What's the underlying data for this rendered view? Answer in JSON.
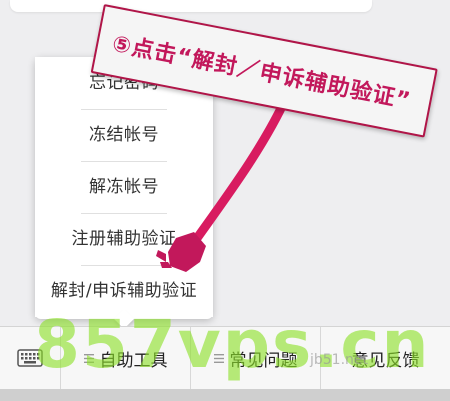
{
  "popup_menu": {
    "items": [
      "忘记密码",
      "冻结帐号",
      "解冻帐号",
      "注册辅助验证",
      "解封/申诉辅助验证"
    ]
  },
  "bottom_bar": {
    "tabs": [
      "自助工具",
      "常见问题",
      "意见反馈"
    ]
  },
  "annotation": {
    "text": "⑤点击“解封／申诉辅助验证”"
  },
  "watermark": {
    "text": "857vps.cn",
    "jb_text": "jb51.net"
  },
  "colors": {
    "annotation": "#c2185b",
    "annotation_border": "#b01548",
    "watermark": "#8ce128",
    "bar_background": "#f7f7f7"
  },
  "icons": {
    "keyboard": "keyboard-icon",
    "menu": "menu-lines-icon",
    "hand": "pointing-hand-icon"
  }
}
